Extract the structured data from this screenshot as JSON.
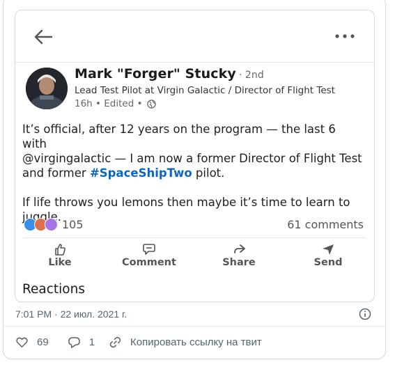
{
  "post": {
    "author_name": "Mark \"Forger\" Stucky",
    "degree": "· 2nd",
    "headline": "Lead Test Pilot at Virgin Galactic / Director of Flight Test",
    "meta": "16h • Edited •",
    "body_line1": "It’s official, after 12 years on the program — the last 6 with",
    "body_line2": "@virgingalactic — I am now a former Director of Flight Test",
    "body_line3_pre": "and former ",
    "hashtag": "#SpaceShipTwo",
    "body_line3_post": " pilot.",
    "body_para2_line1": "If life throws you lemons then maybe it’s time to learn to",
    "body_para2_line2": "juggle.",
    "reaction_count": "105",
    "comments": "61 comments",
    "actions": {
      "like": "Like",
      "comment": "Comment",
      "share": "Share",
      "send": "Send"
    },
    "reactions_title": "Reactions"
  },
  "tweet": {
    "timestamp": "7:01 PM · 22 июл. 2021 г.",
    "likes": "69",
    "replies": "1",
    "copy_link": "Копировать ссылку на твит"
  },
  "colors": {
    "hashtag": "#0a66c2",
    "like_blue": "#378fe9",
    "love_red": "#df704d",
    "support_purple": "#a872e8",
    "muted_text": "#536471"
  },
  "icons": [
    "back-arrow-icon",
    "more-dots-icon",
    "globe-icon",
    "like-icon",
    "comment-icon",
    "share-icon",
    "send-icon",
    "heart-icon",
    "reply-icon",
    "link-icon",
    "info-icon"
  ]
}
